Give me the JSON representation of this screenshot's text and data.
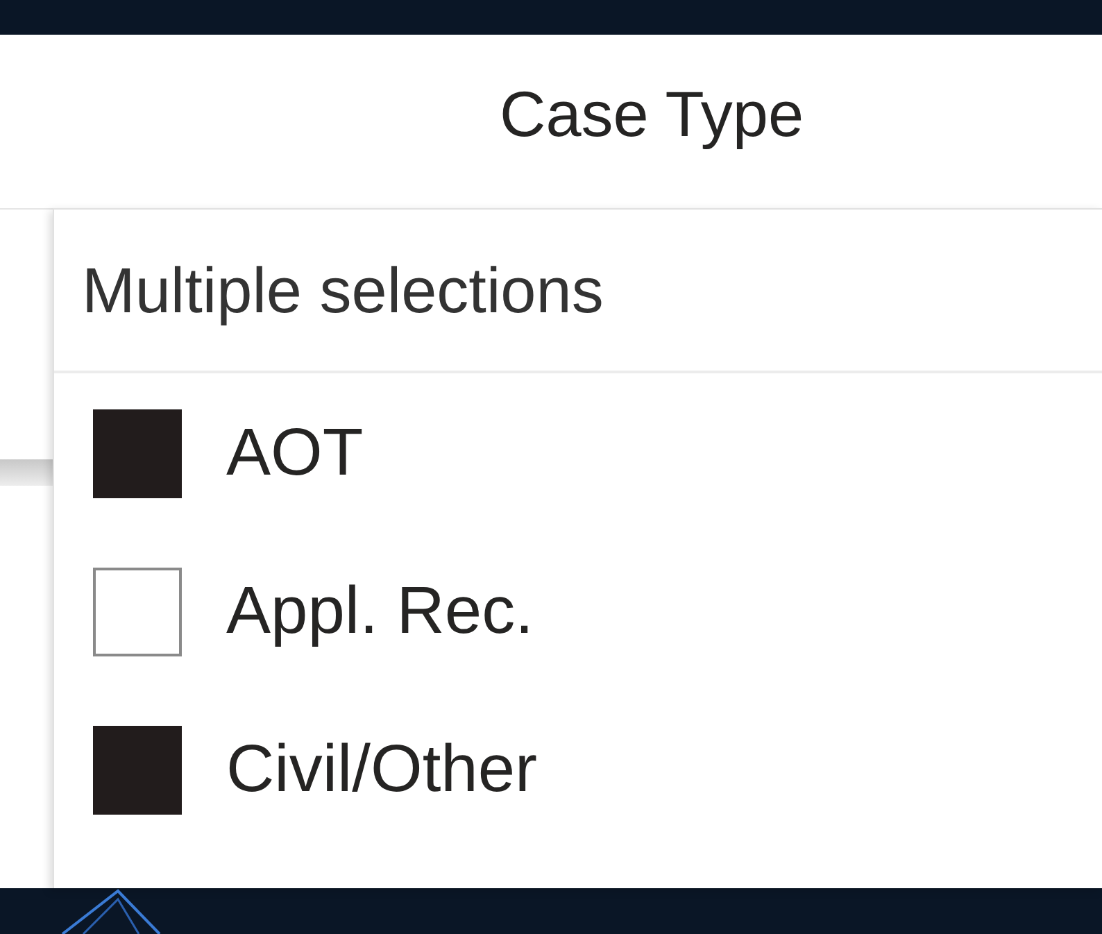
{
  "slicer": {
    "title": "Case Type"
  },
  "dropdown": {
    "value": "Multiple selections",
    "items": [
      {
        "label": "AOT",
        "checked": true
      },
      {
        "label": "Appl. Rec.",
        "checked": false
      },
      {
        "label": "Civil/Other",
        "checked": true
      }
    ]
  }
}
